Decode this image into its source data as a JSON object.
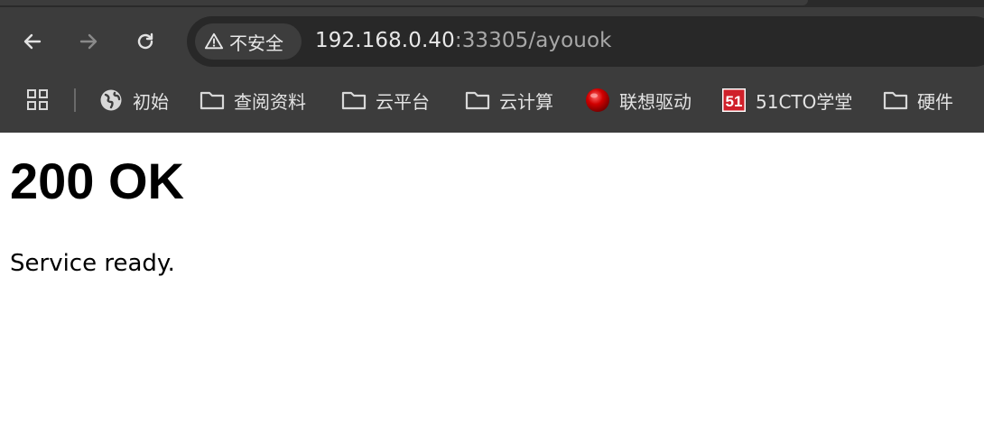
{
  "browser": {
    "security_label": "不安全",
    "url_host": "192.168.0.40",
    "url_path": ":33305/ayouok",
    "nav": {
      "back": "back-arrow-icon",
      "forward": "forward-arrow-icon",
      "reload": "reload-icon"
    }
  },
  "bookmarks": {
    "items": [
      {
        "label": "初始",
        "icon": "globe-icon"
      },
      {
        "label": "查阅资料",
        "icon": "folder-icon"
      },
      {
        "label": "云平台",
        "icon": "folder-icon"
      },
      {
        "label": "云计算",
        "icon": "folder-icon"
      },
      {
        "label": "联想驱动",
        "icon": "lenovo-ball-icon"
      },
      {
        "label": "51CTO学堂",
        "icon": "51cto-icon"
      },
      {
        "label": "硬件",
        "icon": "folder-icon"
      }
    ]
  },
  "page": {
    "heading": "200 OK",
    "message": "Service ready."
  },
  "colors": {
    "chrome_bg": "#3c3c3c",
    "omnibox_bg": "#282828",
    "text_light": "#e3e3e3",
    "page_bg": "#ffffff"
  }
}
